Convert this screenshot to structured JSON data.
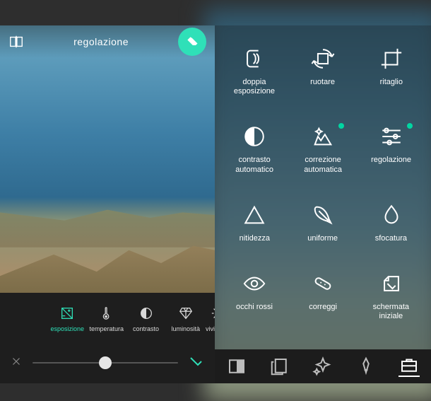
{
  "editor": {
    "title": "regolazione",
    "fab_icon": "eraser-icon",
    "compare_icon": "compare-icon",
    "adjustments": [
      {
        "id": "vividezza",
        "label": "vividezza",
        "icon": "sun"
      },
      {
        "id": "luminosita",
        "label": "luminosità",
        "icon": "diamond"
      },
      {
        "id": "contrasto",
        "label": "contrasto",
        "icon": "halfcircle"
      },
      {
        "id": "temperatura",
        "label": "temperatura",
        "icon": "thermo"
      },
      {
        "id": "esposizione",
        "label": "esposizione",
        "icon": "exposure",
        "active": true
      }
    ],
    "slider": {
      "value": 50,
      "min": 0,
      "max": 100
    },
    "apply_icon": "check-icon",
    "cancel_icon": "x-icon"
  },
  "tools": {
    "grid": [
      {
        "id": "ritaglio",
        "label": "ritaglio",
        "icon": "crop"
      },
      {
        "id": "ruotare",
        "label": "ruotare",
        "icon": "rotate"
      },
      {
        "id": "doppia",
        "label": "doppia\nesposizione",
        "icon": "doubleexp"
      },
      {
        "id": "regolazione",
        "label": "regolazione",
        "icon": "sliders",
        "dot": true
      },
      {
        "id": "corr-auto",
        "label": "correzione\nautomatica",
        "icon": "autofix",
        "dot": true
      },
      {
        "id": "contr-auto",
        "label": "contrasto\nautomatico",
        "icon": "autocontrast"
      },
      {
        "id": "sfocatura",
        "label": "sfocatura",
        "icon": "drop"
      },
      {
        "id": "uniforme",
        "label": "uniforme",
        "icon": "feather"
      },
      {
        "id": "nitidezza",
        "label": "nitidezza",
        "icon": "triangle"
      },
      {
        "id": "schermata",
        "label": "schermata\niniziale",
        "icon": "splash"
      },
      {
        "id": "correggi",
        "label": "correggi",
        "icon": "patch"
      },
      {
        "id": "occhi-rossi",
        "label": "occhi rossi",
        "icon": "eye"
      }
    ],
    "bottom_tabs": [
      {
        "id": "tab-toolbox",
        "icon": "toolbox",
        "active": true
      },
      {
        "id": "tab-brush",
        "icon": "brush"
      },
      {
        "id": "tab-sparkle",
        "icon": "sparkle"
      },
      {
        "id": "tab-frames",
        "icon": "frames"
      },
      {
        "id": "tab-overlay",
        "icon": "overlay"
      }
    ]
  },
  "colors": {
    "accent": "#2fe0b8"
  }
}
